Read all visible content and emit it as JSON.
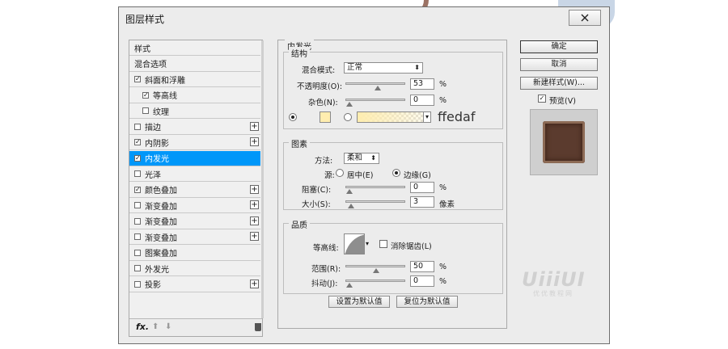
{
  "dialog": {
    "title": "图层样式",
    "close_icon": "close-icon"
  },
  "style_list": {
    "items": [
      {
        "label": "样式",
        "checkbox": false,
        "checked": false,
        "indent": false,
        "plus": false,
        "selected": false
      },
      {
        "label": "混合选项",
        "checkbox": false,
        "checked": false,
        "indent": false,
        "plus": false,
        "selected": false
      },
      {
        "label": "斜面和浮雕",
        "checkbox": true,
        "checked": true,
        "indent": false,
        "plus": false,
        "selected": false
      },
      {
        "label": "等高线",
        "checkbox": true,
        "checked": true,
        "indent": true,
        "plus": false,
        "selected": false
      },
      {
        "label": "纹理",
        "checkbox": true,
        "checked": false,
        "indent": true,
        "plus": false,
        "selected": false
      },
      {
        "label": "描边",
        "checkbox": true,
        "checked": false,
        "indent": false,
        "plus": true,
        "selected": false
      },
      {
        "label": "内阴影",
        "checkbox": true,
        "checked": true,
        "indent": false,
        "plus": true,
        "selected": false
      },
      {
        "label": "内发光",
        "checkbox": true,
        "checked": true,
        "indent": false,
        "plus": false,
        "selected": true
      },
      {
        "label": "光泽",
        "checkbox": true,
        "checked": false,
        "indent": false,
        "plus": false,
        "selected": false
      },
      {
        "label": "颜色叠加",
        "checkbox": true,
        "checked": true,
        "indent": false,
        "plus": true,
        "selected": false
      },
      {
        "label": "渐变叠加",
        "checkbox": true,
        "checked": false,
        "indent": false,
        "plus": true,
        "selected": false
      },
      {
        "label": "渐变叠加",
        "checkbox": true,
        "checked": false,
        "indent": false,
        "plus": true,
        "selected": false
      },
      {
        "label": "渐变叠加",
        "checkbox": true,
        "checked": false,
        "indent": false,
        "plus": true,
        "selected": false
      },
      {
        "label": "图案叠加",
        "checkbox": true,
        "checked": false,
        "indent": false,
        "plus": false,
        "selected": false
      },
      {
        "label": "外发光",
        "checkbox": true,
        "checked": false,
        "indent": false,
        "plus": false,
        "selected": false
      },
      {
        "label": "投影",
        "checkbox": true,
        "checked": false,
        "indent": false,
        "plus": true,
        "selected": false
      }
    ],
    "footer": {
      "fx_label": "fx",
      "fx_suffix": "."
    }
  },
  "panel": {
    "title": "内发光",
    "structure": {
      "title": "结构",
      "blend_mode_label": "混合模式:",
      "blend_mode_value": "正常",
      "opacity_label": "不透明度(O):",
      "opacity_value": "53",
      "opacity_unit": "%",
      "opacity_level": 0.53,
      "noise_label": "杂色(N):",
      "noise_value": "0",
      "noise_unit": "%",
      "noise_level": 0,
      "swatch_color": "#ffedaf",
      "hex_text": "ffedaf"
    },
    "elements": {
      "title": "图素",
      "method_label": "方法:",
      "method_value": "柔和",
      "source_label": "源:",
      "source_center": "居中(E)",
      "source_edge": "边缘(G)",
      "choke_label": "阻塞(C):",
      "choke_value": "0",
      "choke_unit": "%",
      "choke_level": 0,
      "size_label": "大小(S):",
      "size_value": "3",
      "size_unit": "像素",
      "size_level": 0.03
    },
    "quality": {
      "title": "品质",
      "contour_label": "等高线:",
      "antialias_label": "消除锯齿(L)",
      "range_label": "范围(R):",
      "range_value": "50",
      "range_unit": "%",
      "range_level": 0.5,
      "jitter_label": "抖动(J):",
      "jitter_value": "0",
      "jitter_unit": "%",
      "jitter_level": 0
    },
    "make_default": "设置为默认值",
    "reset_default": "复位为默认值"
  },
  "right": {
    "ok": "确定",
    "cancel": "取消",
    "new_style": "新建样式(W)...",
    "preview_label": "预览(V)",
    "preview_checked": true
  },
  "watermark": {
    "main": "UiiiUI",
    "sub": "优优教程网"
  },
  "colors": {
    "selection": "#0097f9",
    "glow": "#ffedaf",
    "preview_tile": "#5b3b2e"
  }
}
